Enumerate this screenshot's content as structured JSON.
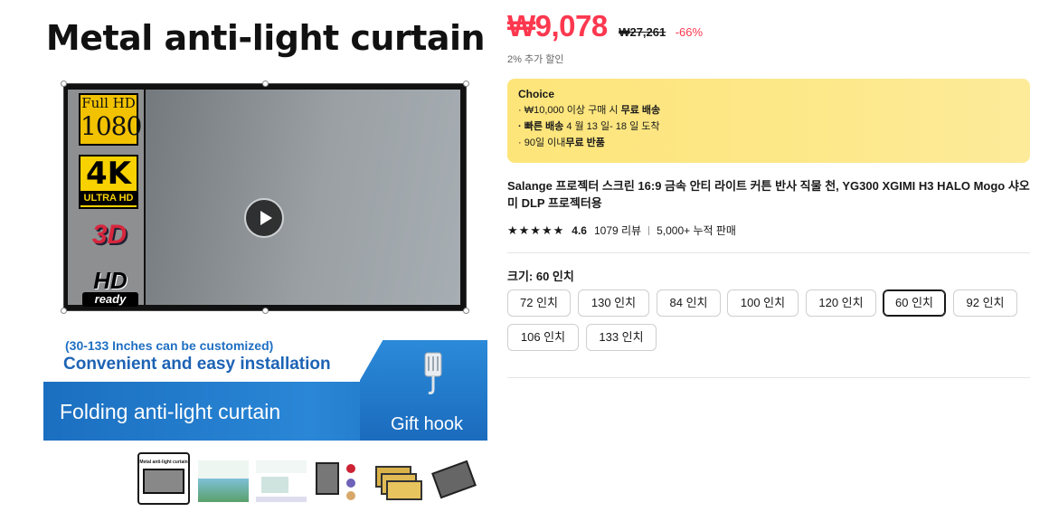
{
  "gallery": {
    "main_image": {
      "title": "Metal anti-light curtain",
      "badges": {
        "fullhd_top": "Full HD",
        "fullhd_bottom": "1080",
        "uhd_top": "4K",
        "uhd_bottom": "ULTRA HD",
        "three_d": "3D",
        "hd_top": "HD",
        "hd_bottom": "ready"
      },
      "sub1": "(30-133 Inches can be customized)",
      "sub2": "Convenient and easy installation",
      "band_main": "Folding anti-light curtain",
      "band_gift": "Gift hook"
    },
    "thumbnails": [
      {
        "title": "Metal anti-light curtain",
        "active": true
      },
      {
        "title": "",
        "active": false
      },
      {
        "title": "",
        "active": false
      },
      {
        "title": "",
        "active": false
      },
      {
        "title": "",
        "active": false
      },
      {
        "title": "",
        "active": false
      }
    ]
  },
  "price": {
    "current": "₩9,078",
    "original": "₩27,261",
    "discount": "-66%",
    "extra": "2% 추가 할인"
  },
  "choice": {
    "title": "Choice",
    "line1_pre": "· ₩10,000 이상 구매 시 ",
    "line1_bold": "무료 배송",
    "line2_bold": "· 빠른 배송",
    "line2_post": " 4 월 13 일- 18 일 도착",
    "line3_pre": "· 90일 이내",
    "line3_bold": "무료 반품"
  },
  "product": {
    "title": "Salange 프로젝터 스크린 16:9 금속 안티 라이트 커튼 반사 직물 천, YG300 XGIMI H3 HALO Mogo 샤오미 DLP 프로젝터용",
    "rating": "4.6",
    "reviews": "1079 리뷰",
    "sold": "5,000+ 누적 판매"
  },
  "size": {
    "label": "크기: 60 인치",
    "options": [
      "72 인치",
      "130 인치",
      "84 인치",
      "100 인치",
      "120 인치",
      "60 인치",
      "92 인치",
      "106 인치",
      "133 인치"
    ],
    "selected": "60 인치"
  },
  "colors": {
    "accent": "#fd384f",
    "choice_bg": "#fde57a"
  }
}
